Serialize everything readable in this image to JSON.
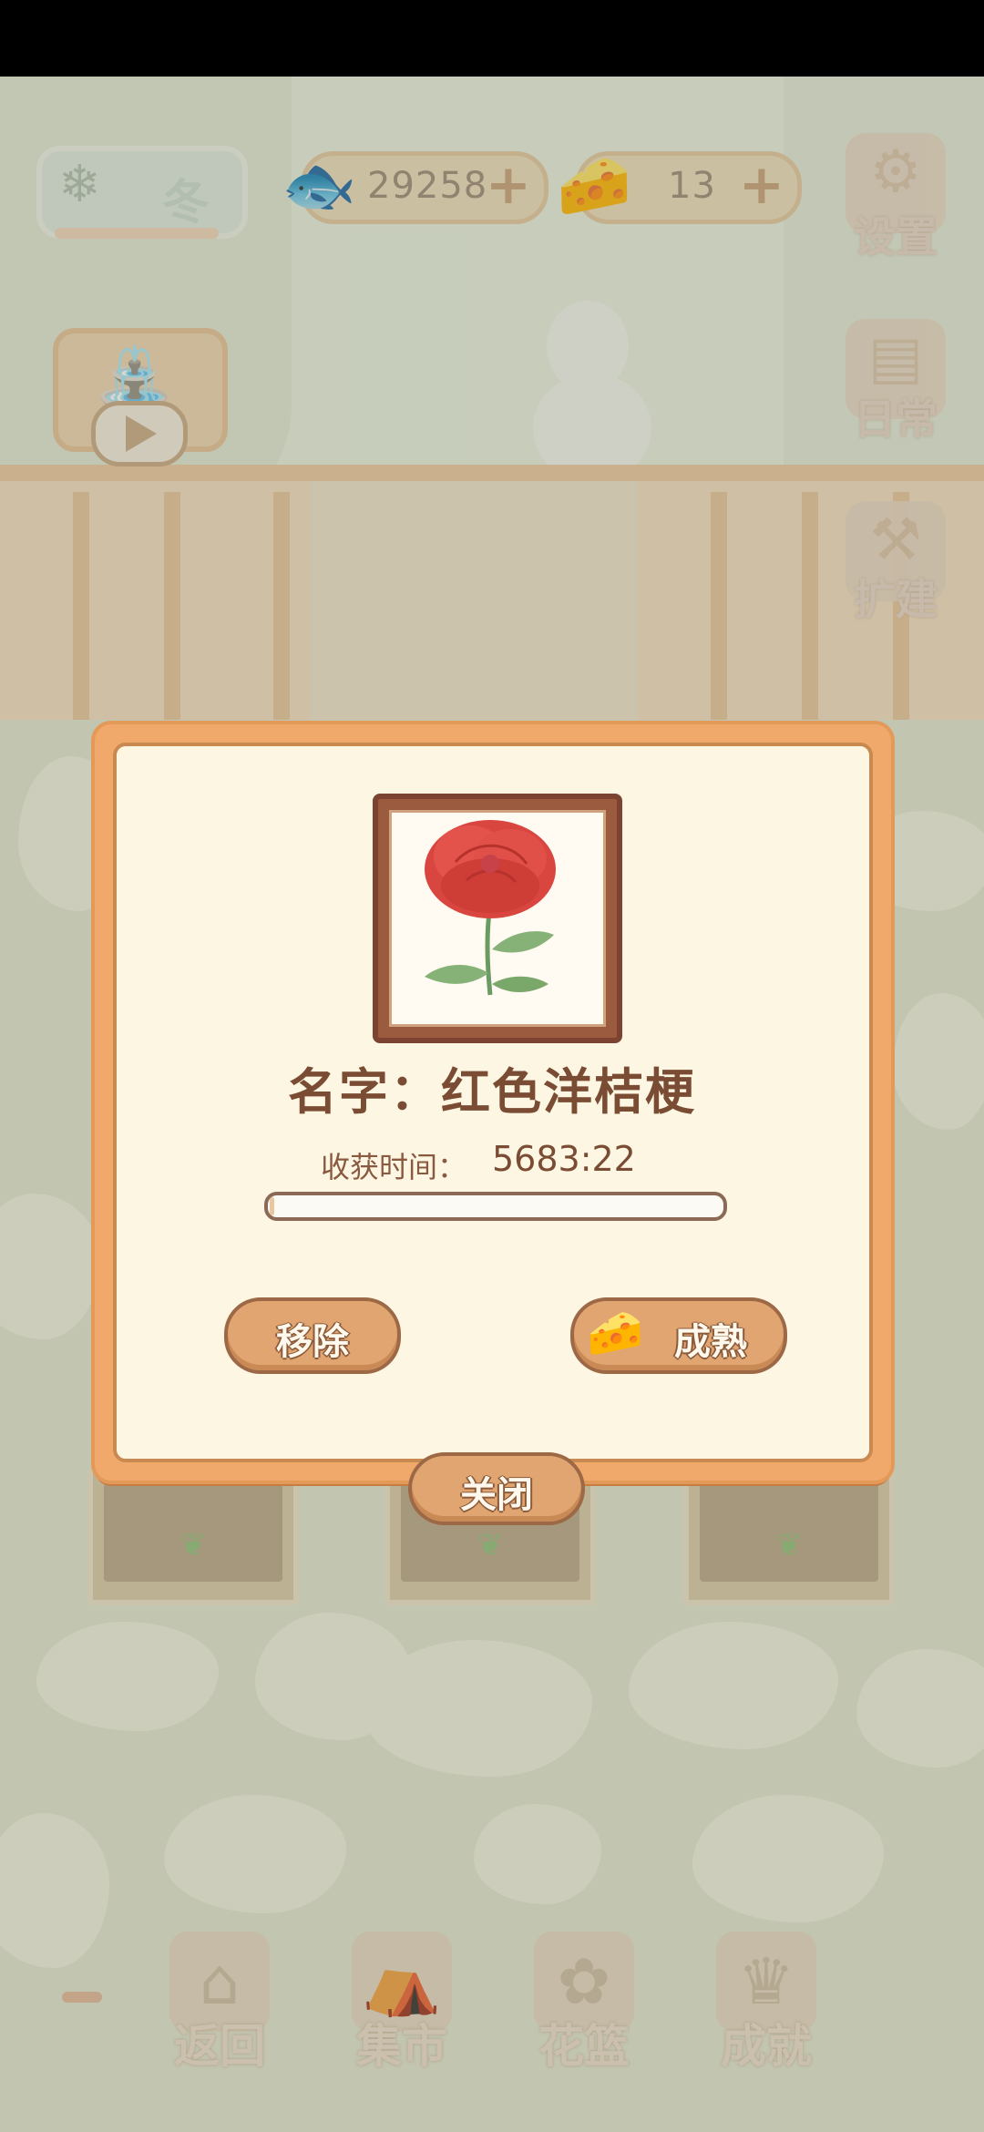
{
  "hud": {
    "season_label": "冬",
    "fish_count": "29258",
    "cheese_count": "13",
    "fish_icon": "fish-bone-icon",
    "cheese_icon": "cheese-icon",
    "plus_label": "+"
  },
  "side_menu": [
    {
      "label": "设置",
      "icon": "gear-icon"
    },
    {
      "label": "日常",
      "icon": "daily-note-icon"
    },
    {
      "label": "扩建",
      "icon": "hammer-icon"
    }
  ],
  "water_button": {
    "icon": "watering-can-icon",
    "play_icon": "play-icon"
  },
  "bottom_nav": [
    {
      "label": "返回",
      "icon": "window-icon"
    },
    {
      "label": "集市",
      "icon": "market-stall-icon"
    },
    {
      "label": "花篮",
      "icon": "flower-basket-icon"
    },
    {
      "label": "成就",
      "icon": "trophy-icon"
    }
  ],
  "dialog": {
    "name": "名字：红色洋桔梗",
    "harvest_label": "收获时间：",
    "harvest_value": "5683:22",
    "progress": 0.01,
    "remove_label": "移除",
    "mature_label": "成熟",
    "close_label": "关闭",
    "flower_icon": "red-eustoma-icon"
  },
  "colors": {
    "dialog_border": "#f0a96a",
    "dialog_bg": "#fdf6e3",
    "button_fill": "#e0a570",
    "text_brown": "#7a4c34",
    "flower_red": "#d9453f"
  }
}
